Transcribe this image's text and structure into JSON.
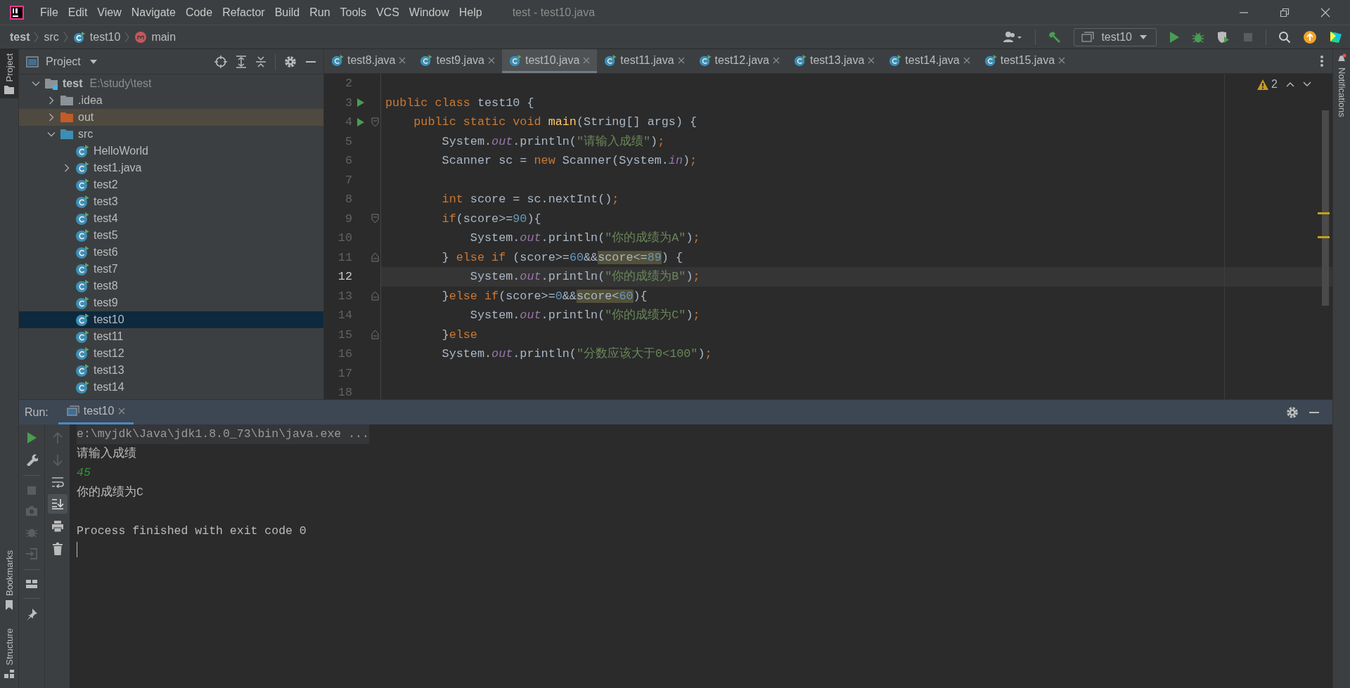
{
  "window": {
    "title": "test - test10.java",
    "menu": [
      "File",
      "Edit",
      "View",
      "Navigate",
      "Code",
      "Refactor",
      "Build",
      "Run",
      "Tools",
      "VCS",
      "Window",
      "Help"
    ]
  },
  "breadcrumbs": [
    {
      "label": "test",
      "kind": "project"
    },
    {
      "label": "src",
      "kind": "folder"
    },
    {
      "label": "test10",
      "kind": "class"
    },
    {
      "label": "main",
      "kind": "method"
    }
  ],
  "toolbar": {
    "run_configuration": "test10"
  },
  "side_tabs": {
    "left_top": [
      {
        "label": "Project",
        "selected": true
      }
    ],
    "left_bottom": [
      {
        "label": "Bookmarks",
        "selected": false
      },
      {
        "label": "Structure",
        "selected": false
      }
    ],
    "right": [
      {
        "label": "Notifications",
        "selected": false
      }
    ]
  },
  "project": {
    "title": "Project",
    "tree": [
      {
        "label": "test",
        "path": "E:\\study\\test",
        "kind": "project",
        "expanded": true,
        "selected": false,
        "children": [
          {
            "label": ".idea",
            "kind": "folder",
            "expanded": false,
            "selected": false
          },
          {
            "label": "out",
            "kind": "excluded",
            "expanded": false,
            "selected": false
          },
          {
            "label": "src",
            "kind": "source",
            "expanded": true,
            "selected": false,
            "children": [
              {
                "label": "HelloWorld",
                "kind": "class",
                "selected": false
              },
              {
                "label": "test1.java",
                "kind": "class",
                "expanded": false,
                "selected": false
              },
              {
                "label": "test2",
                "kind": "class",
                "selected": false
              },
              {
                "label": "test3",
                "kind": "class",
                "selected": false
              },
              {
                "label": "test4",
                "kind": "class",
                "selected": false
              },
              {
                "label": "test5",
                "kind": "class",
                "selected": false
              },
              {
                "label": "test6",
                "kind": "class",
                "selected": false
              },
              {
                "label": "test7",
                "kind": "class",
                "selected": false
              },
              {
                "label": "test8",
                "kind": "class",
                "selected": false
              },
              {
                "label": "test9",
                "kind": "class",
                "selected": false
              },
              {
                "label": "test10",
                "kind": "class",
                "selected": true
              },
              {
                "label": "test11",
                "kind": "class",
                "selected": false
              },
              {
                "label": "test12",
                "kind": "class",
                "selected": false
              },
              {
                "label": "test13",
                "kind": "class",
                "selected": false
              },
              {
                "label": "test14",
                "kind": "class",
                "selected": false
              }
            ]
          }
        ]
      }
    ]
  },
  "editor": {
    "tabs": [
      {
        "label": "test8.java",
        "selected": false
      },
      {
        "label": "test9.java",
        "selected": false
      },
      {
        "label": "test10.java",
        "selected": true
      },
      {
        "label": "test11.java",
        "selected": false
      },
      {
        "label": "test12.java",
        "selected": false
      },
      {
        "label": "test13.java",
        "selected": false
      },
      {
        "label": "test14.java",
        "selected": false
      },
      {
        "label": "test15.java",
        "selected": false
      }
    ],
    "warnings": "2",
    "lines": [
      {
        "number": "2",
        "current": false
      },
      {
        "number": "3",
        "current": false,
        "run": true,
        "kind": "top",
        "tokens": [
          {
            "kind": "kw",
            "text": "public class "
          },
          {
            "kind": "plain",
            "text": "test10 {"
          }
        ]
      },
      {
        "number": "4",
        "current": false,
        "run": true,
        "fold_open": true,
        "kind": "member",
        "tokens": [
          {
            "kind": "kw",
            "text": "public static void "
          },
          {
            "kind": "method",
            "text": "main"
          },
          {
            "kind": "plain",
            "text": "(String[] args) {"
          }
        ]
      },
      {
        "number": "5",
        "current": false,
        "kind": "statement",
        "tokens": [
          {
            "kind": "plain",
            "text": "System."
          },
          {
            "kind": "field",
            "text": "out"
          },
          {
            "kind": "plain",
            "text": ".println("
          },
          {
            "kind": "str",
            "text": "\"请输入成绩\""
          },
          {
            "kind": "plain",
            "text": ")"
          },
          {
            "kind": "kw",
            "text": ";"
          }
        ]
      },
      {
        "number": "6",
        "current": false,
        "kind": "statement",
        "tokens": [
          {
            "kind": "plain",
            "text": "Scanner sc = "
          },
          {
            "kind": "kw",
            "text": "new "
          },
          {
            "kind": "plain",
            "text": "Scanner(System."
          },
          {
            "kind": "field",
            "text": "in"
          },
          {
            "kind": "plain",
            "text": ")"
          },
          {
            "kind": "kw",
            "text": ";"
          }
        ]
      },
      {
        "number": "7",
        "current": false
      },
      {
        "number": "8",
        "current": false,
        "kind": "statement",
        "tokens": [
          {
            "kind": "kw",
            "text": "int "
          },
          {
            "kind": "plain",
            "text": "score = sc.nextInt()"
          },
          {
            "kind": "kw",
            "text": ";"
          }
        ]
      },
      {
        "number": "9",
        "current": false,
        "fold_open": true,
        "kind": "statement",
        "tokens": [
          {
            "kind": "kw",
            "text": "if"
          },
          {
            "kind": "plain",
            "text": "(score>="
          },
          {
            "kind": "num",
            "text": "90"
          },
          {
            "kind": "plain",
            "text": "){"
          }
        ]
      },
      {
        "number": "10",
        "current": false,
        "kind": "nested",
        "tokens": [
          {
            "kind": "plain",
            "text": "System."
          },
          {
            "kind": "field",
            "text": "out"
          },
          {
            "kind": "plain",
            "text": ".println("
          },
          {
            "kind": "str",
            "text": "\"你的成绩为A\""
          },
          {
            "kind": "plain",
            "text": ")"
          },
          {
            "kind": "kw",
            "text": ";"
          }
        ]
      },
      {
        "number": "11",
        "current": false,
        "fold_close": true,
        "kind": "statement",
        "tokens": [
          {
            "kind": "plain",
            "text": "} "
          },
          {
            "kind": "kw",
            "text": "else if "
          },
          {
            "kind": "plain",
            "text": "(score>="
          },
          {
            "kind": "num",
            "text": "60"
          },
          {
            "kind": "plain",
            "text": "&&"
          },
          {
            "kind": "usage",
            "text": "score<="
          },
          {
            "kind": "usagenum",
            "text": "89"
          },
          {
            "kind": "plain",
            "text": ") {"
          }
        ]
      },
      {
        "number": "12",
        "current": true,
        "kind": "nested",
        "tokens": [
          {
            "kind": "plain",
            "text": "System."
          },
          {
            "kind": "field",
            "text": "out"
          },
          {
            "kind": "plain",
            "text": ".println("
          },
          {
            "kind": "str",
            "text": "\"你的成绩为B\""
          },
          {
            "kind": "plain",
            "text": ")"
          },
          {
            "kind": "kw",
            "text": ";"
          }
        ]
      },
      {
        "number": "13",
        "current": false,
        "fold_close": true,
        "kind": "statement",
        "tokens": [
          {
            "kind": "plain",
            "text": "}"
          },
          {
            "kind": "kw",
            "text": "else if"
          },
          {
            "kind": "plain",
            "text": "(score>="
          },
          {
            "kind": "num",
            "text": "0"
          },
          {
            "kind": "plain",
            "text": "&&"
          },
          {
            "kind": "usage",
            "text": "score<"
          },
          {
            "kind": "usagenum",
            "text": "60"
          },
          {
            "kind": "plain",
            "text": "){"
          }
        ]
      },
      {
        "number": "14",
        "current": false,
        "kind": "nested",
        "tokens": [
          {
            "kind": "plain",
            "text": "System."
          },
          {
            "kind": "field",
            "text": "out"
          },
          {
            "kind": "plain",
            "text": ".println("
          },
          {
            "kind": "str",
            "text": "\"你的成绩为C\""
          },
          {
            "kind": "plain",
            "text": ")"
          },
          {
            "kind": "kw",
            "text": ";"
          }
        ]
      },
      {
        "number": "15",
        "current": false,
        "fold_close": true,
        "kind": "statement",
        "tokens": [
          {
            "kind": "plain",
            "text": "}"
          },
          {
            "kind": "kw",
            "text": "else"
          }
        ]
      },
      {
        "number": "16",
        "current": false,
        "kind": "statement",
        "tokens": [
          {
            "kind": "plain",
            "text": "System."
          },
          {
            "kind": "field",
            "text": "out"
          },
          {
            "kind": "plain",
            "text": ".println("
          },
          {
            "kind": "str",
            "text": "\"分数应该大于0<100\""
          },
          {
            "kind": "plain",
            "text": ")"
          },
          {
            "kind": "kw",
            "text": ";"
          }
        ]
      },
      {
        "number": "17",
        "current": false
      },
      {
        "number": "18",
        "current": false
      }
    ]
  },
  "run": {
    "label": "Run:",
    "tabs": [
      {
        "label": "test10",
        "selected": true
      }
    ],
    "console": [
      {
        "kind": "command",
        "text": "e:\\myjdk\\Java\\jdk1.8.0_73\\bin\\java.exe ..."
      },
      {
        "kind": "output",
        "text": "请输入成绩"
      },
      {
        "kind": "input",
        "text": "45"
      },
      {
        "kind": "output",
        "text": "你的成绩为C"
      },
      {
        "kind": "exit",
        "text": "Process finished with exit code 0"
      }
    ]
  }
}
